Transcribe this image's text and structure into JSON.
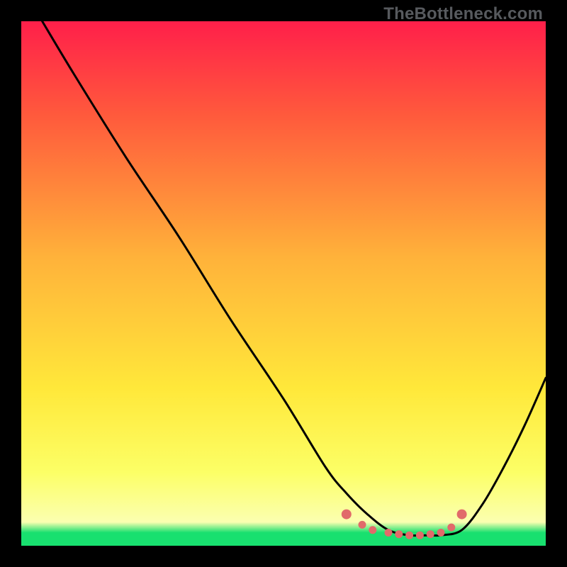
{
  "watermark": "TheBottleneck.com",
  "colors": {
    "bg_black": "#000000",
    "watermark_gray": "#575a5e",
    "gradient_top": "#ff1f4a",
    "gradient_upper": "#ff5a3c",
    "gradient_mid": "#ffb23a",
    "gradient_lower": "#ffe83a",
    "gradient_low2": "#fcff66",
    "gradient_base_yellow": "#fbffb0",
    "gradient_green": "#18e06f",
    "curve_black": "#000000",
    "dot_pink": "#e16a6a"
  },
  "chart_data": {
    "type": "line",
    "title": "",
    "xlabel": "",
    "ylabel": "",
    "xlim": [
      0,
      100
    ],
    "ylim": [
      0,
      100
    ],
    "grid": false,
    "legend": false,
    "series": [
      {
        "name": "bottleneck-curve",
        "x": [
          4,
          10,
          20,
          30,
          40,
          50,
          58,
          62,
          66,
          70,
          74,
          78,
          80,
          84,
          88,
          92,
          96,
          100
        ],
        "y": [
          100,
          90,
          74,
          59,
          43,
          28,
          15,
          10,
          6,
          3,
          2,
          2,
          2,
          3,
          8,
          15,
          23,
          32
        ]
      }
    ],
    "highlight_points": {
      "name": "optimal-range-dots",
      "x": [
        62,
        65,
        67,
        70,
        72,
        74,
        76,
        78,
        80,
        82,
        84
      ],
      "y": [
        6,
        4,
        3,
        2.5,
        2.2,
        2,
        2,
        2.2,
        2.5,
        3.5,
        6
      ]
    },
    "annotations": []
  }
}
